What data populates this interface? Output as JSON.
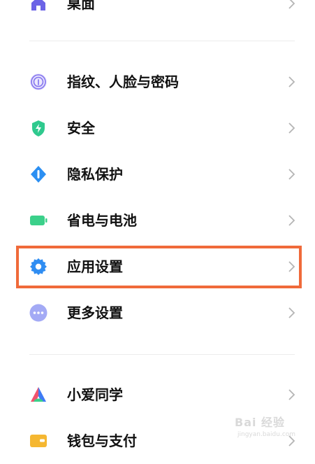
{
  "settings_list": {
    "items": [
      {
        "id": "desktop",
        "label": "桌面",
        "icon": "home-icon",
        "color": "#6b63e6"
      },
      {
        "id": "fingerprint",
        "label": "指纹、人脸与密码",
        "icon": "fingerprint-icon",
        "color": "#8b7cf0"
      },
      {
        "id": "security",
        "label": "安全",
        "icon": "shield-icon",
        "color": "#2fc98e"
      },
      {
        "id": "privacy",
        "label": "隐私保护",
        "icon": "privacy-icon",
        "color": "#2b8ff2"
      },
      {
        "id": "battery",
        "label": "省电与电池",
        "icon": "battery-icon",
        "color": "#3bd08a"
      },
      {
        "id": "apps",
        "label": "应用设置",
        "icon": "gear-icon",
        "color": "#2f8df2"
      },
      {
        "id": "more",
        "label": "更多设置",
        "icon": "more-icon",
        "color": "#a3aaf5"
      },
      {
        "id": "xiaoai",
        "label": "小爱同学",
        "icon": "xiaoai-icon",
        "color": "#3f7bf5"
      },
      {
        "id": "wallet",
        "label": "钱包与支付",
        "icon": "wallet-icon",
        "color": "#f5b731"
      }
    ]
  },
  "highlight": {
    "color": "#f06a3a"
  },
  "watermark": {
    "text": "Bai 经验",
    "sub": "jingyan.baidu.com"
  }
}
